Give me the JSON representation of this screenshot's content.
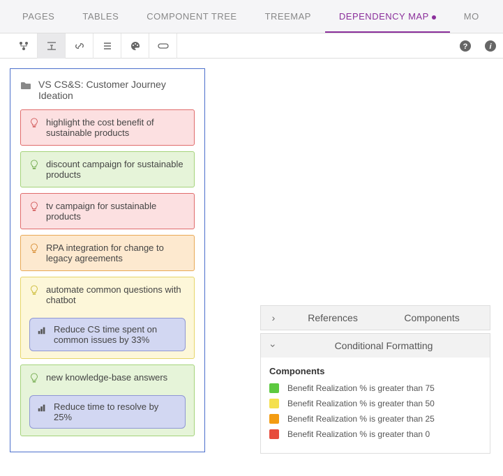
{
  "tabs": {
    "pages": "PAGES",
    "tables": "TABLES",
    "component_tree": "COMPONENT TREE",
    "treemap": "TREEMAP",
    "dependency_map": "DEPENDENCY MAP",
    "more": "MO"
  },
  "panel": {
    "title": "VS CS&S: Customer Journey Ideation",
    "ideas": [
      {
        "text": "highlight the cost benefit of sustainable products"
      },
      {
        "text": "discount campaign for sustainable products"
      },
      {
        "text": "tv campaign for sustainable products"
      },
      {
        "text": "RPA integration for change to legacy agreements"
      },
      {
        "text": "automate common questions with chatbot",
        "sub": "Reduce CS time spent on common issues by 33%"
      },
      {
        "text": "new knowledge-base answers",
        "sub": "Reduce time to resolve by 25%"
      }
    ]
  },
  "accordion": {
    "references": "References",
    "components": "Components",
    "conditional_formatting": "Conditional Formatting"
  },
  "legend": {
    "title": "Components",
    "rows": [
      {
        "color": "#5cc93f",
        "text": "Benefit Realization % is greater than 75"
      },
      {
        "color": "#f4e04d",
        "text": "Benefit Realization % is greater than 50"
      },
      {
        "color": "#f39c12",
        "text": "Benefit Realization % is greater than 25"
      },
      {
        "color": "#e74c3c",
        "text": "Benefit Realization % is greater than 0"
      }
    ]
  },
  "icons": {
    "tree": "tree",
    "align": "align",
    "link": "link",
    "list": "list",
    "palette": "palette",
    "pill": "pill",
    "help": "help",
    "info": "info",
    "folder": "folder"
  }
}
